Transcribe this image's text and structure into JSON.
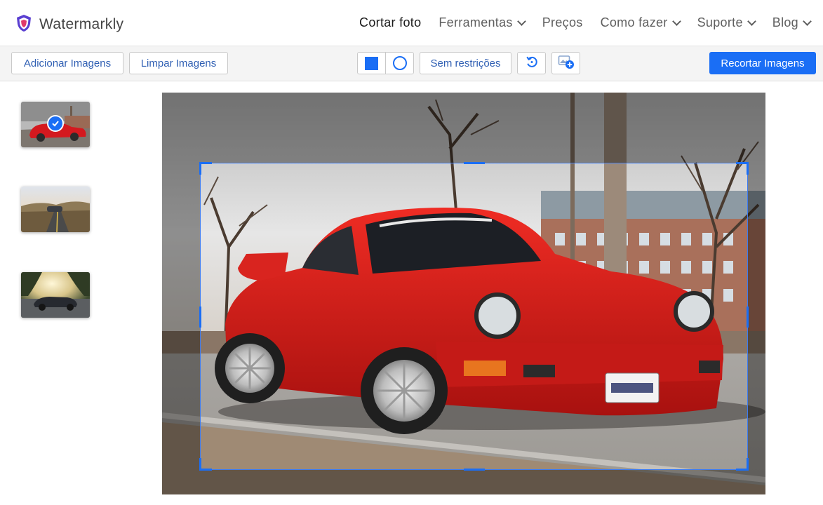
{
  "brand": {
    "name": "Watermarkly",
    "logo_icon": "shield-logo-icon"
  },
  "nav": {
    "items": [
      {
        "label": "Cortar foto",
        "active": true,
        "dropdown": false
      },
      {
        "label": "Ferramentas",
        "active": false,
        "dropdown": true
      },
      {
        "label": "Preços",
        "active": false,
        "dropdown": false
      },
      {
        "label": "Como fazer",
        "active": false,
        "dropdown": true
      },
      {
        "label": "Suporte",
        "active": false,
        "dropdown": true
      },
      {
        "label": "Blog",
        "active": false,
        "dropdown": true
      }
    ]
  },
  "toolbar": {
    "add_images_label": "Adicionar Imagens",
    "clear_images_label": "Limpar Imagens",
    "shape_options": [
      "square-shape-icon",
      "circle-shape-icon"
    ],
    "selected_shape": "square-shape-icon",
    "aspect_label": "Sem restrições",
    "rotate_icon": "rotate-icon",
    "add_image_icon": "add-image-icon",
    "crop_button_label": "Recortar Imagens"
  },
  "thumbnails": [
    {
      "subject": "red sports car",
      "selected": true
    },
    {
      "subject": "car on mountain road",
      "selected": false
    },
    {
      "subject": "car at sunset",
      "selected": false
    }
  ],
  "colors": {
    "accent": "#1a6ef5",
    "toolbar_bg": "#f4f4f4",
    "button_text": "#2f5fb3"
  }
}
